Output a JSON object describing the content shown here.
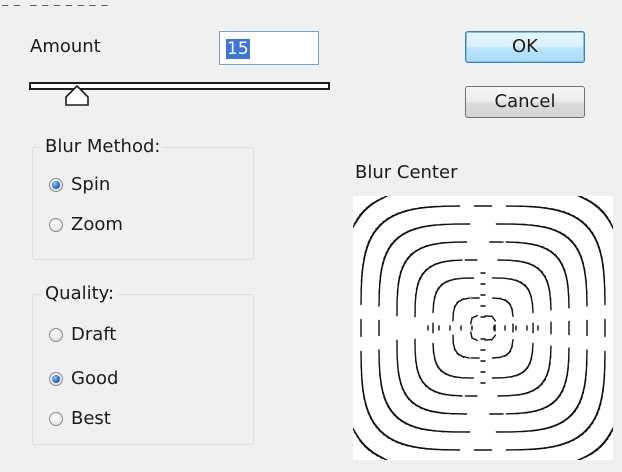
{
  "dialog": {
    "amount": {
      "label": "Amount",
      "value": "15",
      "slider_fraction": 0.15
    },
    "buttons": {
      "ok": "OK",
      "cancel": "Cancel"
    },
    "blur_method": {
      "legend": "Blur Method:",
      "options": [
        {
          "label": "Spin",
          "checked": true
        },
        {
          "label": "Zoom",
          "checked": false
        }
      ]
    },
    "quality": {
      "legend": "Quality:",
      "options": [
        {
          "label": "Draft",
          "checked": false
        },
        {
          "label": "Good",
          "checked": true
        },
        {
          "label": "Best",
          "checked": false
        }
      ]
    },
    "blur_center": {
      "label": "Blur Center"
    }
  },
  "colors": {
    "background": "#f0f0f0",
    "selection": "#3e76d6",
    "ok_border": "#3c7fb1",
    "radio_selected": "#2a6fc9"
  }
}
